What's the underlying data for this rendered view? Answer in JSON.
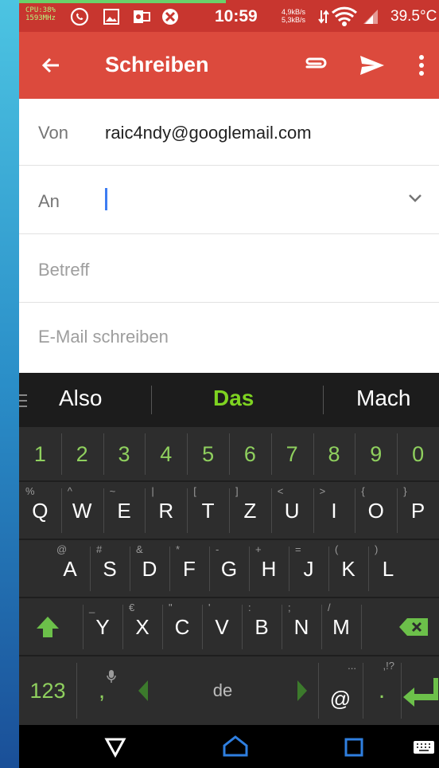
{
  "status_bar": {
    "cpu_line1": "CPU:38%",
    "cpu_line2": "1593MHz",
    "time": "10:59",
    "rate_down": "4,9kB/s",
    "rate_up": "5,3kB/s",
    "temperature": "39.5°C",
    "icons": [
      "whatsapp-icon",
      "gallery-icon",
      "outlook-icon",
      "app-icon",
      "data-transfer-icon",
      "wifi-icon",
      "signal-icon"
    ]
  },
  "app_bar": {
    "title": "Schreiben",
    "icons": [
      "back-arrow-icon",
      "attachment-icon",
      "send-icon",
      "more-vert-icon"
    ],
    "color": "#dc4a3d"
  },
  "form": {
    "from_label": "Von",
    "from_value": "raic4ndy@googlemail.com",
    "to_label": "An",
    "to_value": "",
    "subject_placeholder": "Betreff",
    "body_placeholder": "E-Mail schreiben"
  },
  "keyboard": {
    "suggestions": [
      "Also",
      "Das",
      "Mach"
    ],
    "numbers": [
      "1",
      "2",
      "3",
      "4",
      "5",
      "6",
      "7",
      "8",
      "9",
      "0"
    ],
    "row1": [
      {
        "key": "Q",
        "hint": "%"
      },
      {
        "key": "W",
        "hint": "^"
      },
      {
        "key": "E",
        "hint": "~"
      },
      {
        "key": "R",
        "hint": "|"
      },
      {
        "key": "T",
        "hint": "["
      },
      {
        "key": "Z",
        "hint": "]"
      },
      {
        "key": "U",
        "hint": "<"
      },
      {
        "key": "I",
        "hint": ">"
      },
      {
        "key": "O",
        "hint": "{"
      },
      {
        "key": "P",
        "hint": "}"
      }
    ],
    "row2": [
      {
        "key": "A",
        "hint": "@"
      },
      {
        "key": "S",
        "hint": "#"
      },
      {
        "key": "D",
        "hint": "&"
      },
      {
        "key": "F",
        "hint": "*"
      },
      {
        "key": "G",
        "hint": "-"
      },
      {
        "key": "H",
        "hint": "+"
      },
      {
        "key": "J",
        "hint": "="
      },
      {
        "key": "K",
        "hint": "("
      },
      {
        "key": "L",
        "hint": ")"
      }
    ],
    "row3": [
      {
        "key": "Y",
        "hint": "_"
      },
      {
        "key": "X",
        "hint": "€"
      },
      {
        "key": "C",
        "hint": "\""
      },
      {
        "key": "V",
        "hint": "'"
      },
      {
        "key": "B",
        "hint": ":"
      },
      {
        "key": "N",
        "hint": ";"
      },
      {
        "key": "M",
        "hint": "/"
      }
    ],
    "bottom": {
      "numbers_label": "123",
      "comma": ",",
      "language": "de",
      "at": "@",
      "at_hint": "...",
      "period": ".",
      "period_hint": ",!?"
    },
    "accent_color": "#7ed321"
  },
  "nav_bar": {
    "icons": [
      "back-triangle-icon",
      "home-icon",
      "recents-icon",
      "keyboard-icon"
    ]
  }
}
